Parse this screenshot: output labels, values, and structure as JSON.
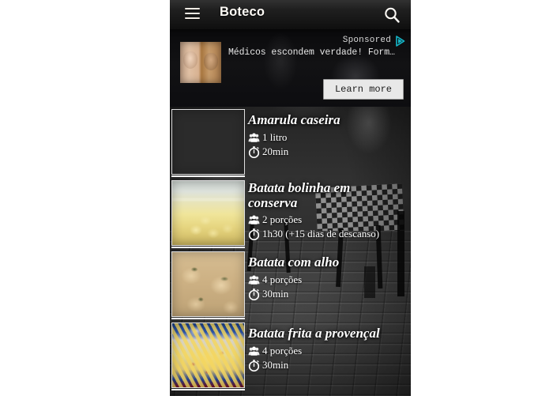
{
  "app": {
    "title": "Boteco",
    "menu_icon": "hamburger-menu-icon",
    "search_icon": "search-icon"
  },
  "ad": {
    "sponsored_label": "Sponsored",
    "adchoices_icon": "adchoices-icon",
    "headline": "Médicos escondem verdade! Form…",
    "cta_label": "Learn more",
    "thumbnail_alt": "ad-thumbnail"
  },
  "icons": {
    "servings": "people-group-icon",
    "time": "stopwatch-icon"
  },
  "list": {
    "items": [
      {
        "title": "Amarula caseira",
        "servings": "1 litro",
        "time": "20min",
        "thumb_alt": "amarula-glasses-thumbnail"
      },
      {
        "title": "Batata bolinha em conserva",
        "servings": "2 porções",
        "time": "1h30 (+15 dias de descanso)",
        "thumb_alt": "potato-jar-thumbnail"
      },
      {
        "title": "Batata com alho",
        "servings": "4 porções",
        "time": "30min",
        "thumb_alt": "roast-potatoes-thumbnail"
      },
      {
        "title": "Batata frita a provençal",
        "servings": "4 porções",
        "time": "30min",
        "thumb_alt": "french-fries-thumbnail"
      }
    ]
  },
  "colors": {
    "appbar_wood": "#7d5227",
    "appbar_text": "#fdfaf5",
    "ad_background": "#0a0a0c",
    "ad_cta_background": "#e8e8e8",
    "adchoices_teal": "#15b7c9",
    "list_text": "#ffffff",
    "page_background": "#ffffff"
  }
}
